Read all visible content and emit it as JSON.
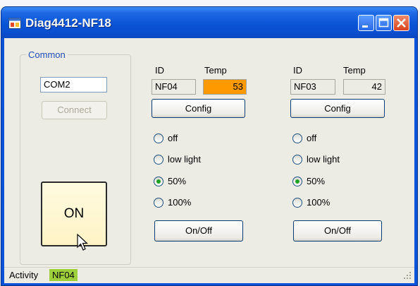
{
  "window": {
    "title": "Diag4412-NF18"
  },
  "common": {
    "legend": "Common",
    "port_value": "COM2",
    "connect_label": "Connect",
    "on_label": "ON"
  },
  "devices": [
    {
      "id_label": "ID",
      "temp_label": "Temp",
      "id_value": "NF04",
      "temp_value": "53",
      "temp_color": "#ff9900",
      "config_label": "Config",
      "radio_options": [
        "off",
        "low light",
        "50%",
        "100%"
      ],
      "selected": "50%",
      "onoff_label": "On/Off"
    },
    {
      "id_label": "ID",
      "temp_label": "Temp",
      "id_value": "NF03",
      "temp_value": "42",
      "temp_color": "#ecebe4",
      "config_label": "Config",
      "radio_options": [
        "off",
        "low light",
        "50%",
        "100%"
      ],
      "selected": "50%",
      "onoff_label": "On/Off"
    }
  ],
  "status": {
    "activity_label": "Activity",
    "activity_value": "NF04",
    "activity_color": "#9ed03c"
  },
  "icons": [
    "app-icon",
    "minimize-icon",
    "maximize-icon",
    "close-icon",
    "mouse-cursor-icon",
    "size-grip-icon"
  ]
}
